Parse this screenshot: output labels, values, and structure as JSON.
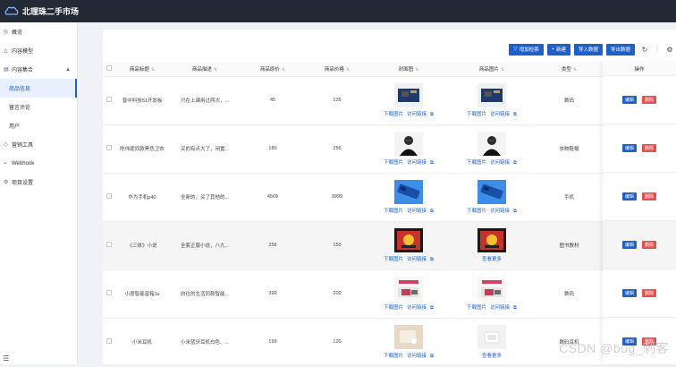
{
  "app": {
    "title": "北理珠二手市场"
  },
  "sidebar": {
    "items": [
      {
        "icon": "eye-icon",
        "label": "概览"
      },
      {
        "icon": "warning-triangle-icon",
        "label": "内容模型"
      },
      {
        "icon": "collection-icon",
        "label": "内容集合",
        "expanded": true
      }
    ],
    "subitems": [
      {
        "label": "商品信息",
        "active": true
      },
      {
        "label": "留言评论"
      },
      {
        "label": "用户"
      }
    ],
    "items_after": [
      {
        "icon": "megaphone-icon",
        "label": "营销工具"
      },
      {
        "icon": "webhook-icon",
        "label": "Webhook"
      },
      {
        "icon": "gear-icon",
        "label": "项目设置"
      }
    ]
  },
  "toolbar": {
    "filter_label": "增加检索",
    "new_label": "新建",
    "import_label": "导入数据",
    "export_label": "导出数据"
  },
  "table": {
    "columns": [
      "商品标题",
      "商品描述",
      "商品原价",
      "商品价格",
      "封面图",
      "商品图片",
      "类型",
      "操作"
    ],
    "rows": [
      {
        "title": "普中科技51开发板",
        "desc": "只在上课用过两次，...",
        "orig": "45",
        "price": "128",
        "cover": "board",
        "cover_links": [
          "下载图片",
          "访问链接"
        ],
        "pics": "board",
        "pics_links": [
          "下载图片",
          "访问链接"
        ],
        "type": "数码"
      },
      {
        "title": "陈伟霆同款黑色卫衣",
        "desc": "买的有点大了，闲置...",
        "orig": "180",
        "price": "256",
        "cover": "person",
        "cover_links": [
          "下载图片",
          "访问链接"
        ],
        "pics": "person",
        "pics_links": [
          "下载图片",
          "访问链接"
        ],
        "type": "衣物鞋帽"
      },
      {
        "title": "华为手机p40",
        "desc": "全新的，买了其他的...",
        "orig": "4569",
        "price": "3999",
        "cover": "phone",
        "cover_links": [
          "下载图片",
          "访问链接"
        ],
        "pics": "phone",
        "pics_links": [
          "下载图片",
          "访问链接"
        ],
        "type": "手机"
      },
      {
        "title": "《三体》小说",
        "desc": "全套正版小说，八九...",
        "orig": "256",
        "price": "150",
        "cover": "book",
        "cover_links": [
          "下载图片",
          "访问链接"
        ],
        "pics": "book",
        "pics_links": [
          "查看更多"
        ],
        "type": "图书教材"
      },
      {
        "title": "小度智能音箱1s",
        "desc": "向往的生活同款智能...",
        "orig": "399",
        "price": "200",
        "cover": "speaker",
        "cover_links": [
          "下载图片",
          "访问链接"
        ],
        "pics": "speaker",
        "pics_links": [
          "下载图片",
          "访问链接"
        ],
        "type": "数码"
      },
      {
        "title": "小米耳机",
        "desc": "小米蓝牙耳机白色、...",
        "orig": "199",
        "price": "120",
        "cover": "earbuds",
        "cover_links": [
          "下载图片",
          "访问链接"
        ],
        "pics": "earbuds-box",
        "pics_links": [
          "查看更多"
        ],
        "type": "数码耳机"
      }
    ],
    "op_edit": "编辑",
    "op_delete": "删除"
  },
  "watermark": "CSDN @bug_刺客",
  "colors": {
    "primary": "#1f5fc9",
    "danger": "#e55050",
    "topbar": "#232a35"
  }
}
